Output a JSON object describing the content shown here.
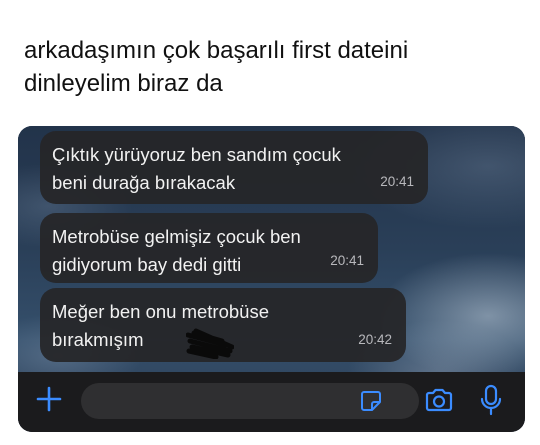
{
  "post": {
    "caption_lines": [
      "arkadaşımın çok başarılı first dateini",
      "dinleyelim biraz da"
    ]
  },
  "chat": {
    "messages": [
      {
        "lines": [
          "Çıktık yürüyoruz ben sandım çocuk",
          "beni durağa bırakacak"
        ],
        "time": "20:41"
      },
      {
        "lines": [
          "Metrobüse gelmişiz çocuk ben",
          "gidiyorum bay dedi gitti"
        ],
        "time": "20:41"
      },
      {
        "lines": [
          "Meğer ben onu metrobüse",
          "bırakmışım"
        ],
        "time": "20:42"
      }
    ]
  },
  "input_bar": {
    "icons": [
      "plus-icon",
      "sticker-icon",
      "camera-icon",
      "microphone-icon"
    ],
    "accent_color": "#3b8cff"
  },
  "colors": {
    "bubble": "#262628",
    "bar": "#1b1b1d",
    "accent": "#3b8cff"
  }
}
